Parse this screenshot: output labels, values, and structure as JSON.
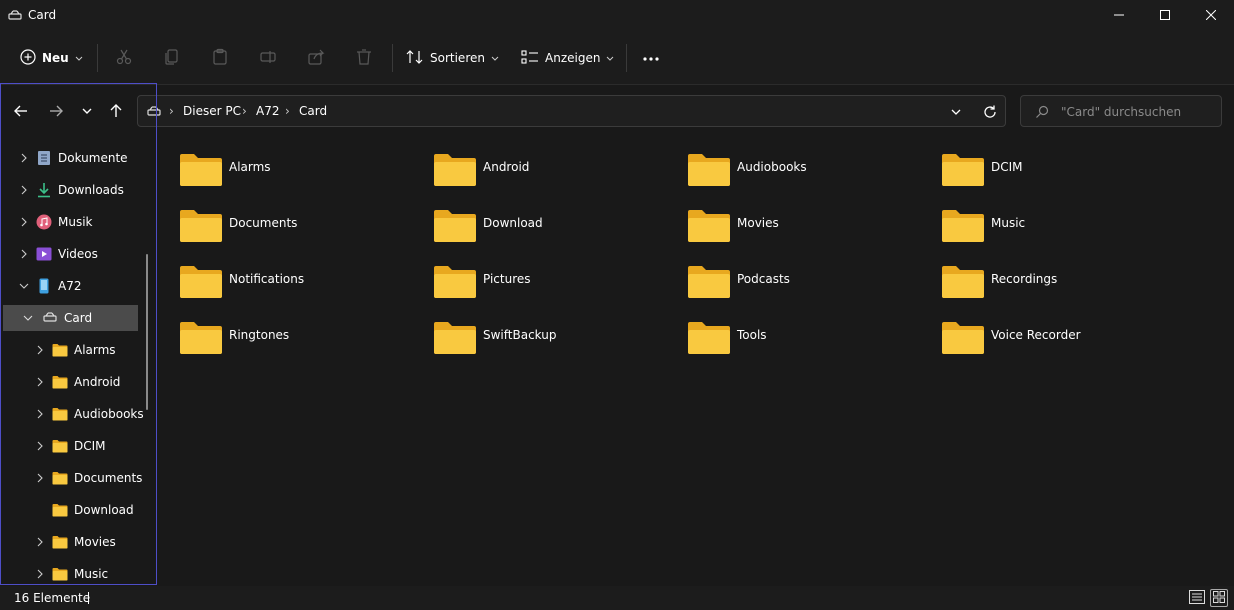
{
  "window": {
    "title": "Card",
    "minimize_icon": "minimize-icon",
    "maximize_icon": "maximize-icon",
    "close_icon": "close-icon"
  },
  "toolbar": {
    "new_label": "Neu",
    "sort_label": "Sortieren",
    "view_label": "Anzeigen",
    "icons": [
      "new-icon",
      "cut-icon",
      "copy-icon",
      "paste-icon",
      "rename-icon",
      "share-icon",
      "delete-icon",
      "sort-icon",
      "view-icon",
      "more-icon"
    ]
  },
  "nav": {
    "breadcrumb": [
      "Dieser PC",
      "A72",
      "Card"
    ],
    "search_placeholder": "\"Card\" durchsuchen"
  },
  "sidebar": {
    "items": [
      {
        "label": "Dokumente",
        "icon": "documents-icon",
        "expanded": false
      },
      {
        "label": "Downloads",
        "icon": "downloads-icon",
        "expanded": false
      },
      {
        "label": "Musik",
        "icon": "music-icon",
        "expanded": false
      },
      {
        "label": "Videos",
        "icon": "videos-icon",
        "expanded": false
      },
      {
        "label": "A72",
        "icon": "phone-icon",
        "expanded": true
      },
      {
        "label": "Card",
        "icon": "drive-icon",
        "expanded": true,
        "selected": true
      },
      {
        "label": "Alarms",
        "icon": "folder-icon"
      },
      {
        "label": "Android",
        "icon": "folder-icon"
      },
      {
        "label": "Audiobooks",
        "icon": "folder-icon"
      },
      {
        "label": "DCIM",
        "icon": "folder-icon"
      },
      {
        "label": "Documents",
        "icon": "folder-icon"
      },
      {
        "label": "Download",
        "icon": "folder-icon"
      },
      {
        "label": "Movies",
        "icon": "folder-icon"
      },
      {
        "label": "Music",
        "icon": "folder-icon"
      }
    ]
  },
  "content": {
    "folders": [
      "Alarms",
      "Android",
      "Audiobooks",
      "DCIM",
      "Documents",
      "Download",
      "Movies",
      "Music",
      "Notifications",
      "Pictures",
      "Podcasts",
      "Recordings",
      "Ringtones",
      "SwiftBackup",
      "Tools",
      "Voice Recorder"
    ]
  },
  "status": {
    "count_text": "16 Elemente"
  },
  "colors": {
    "folder": "#f9c940",
    "folder_back": "#e8a81f",
    "selection": "#4b4b4b",
    "focus": "#4e4ec8"
  }
}
